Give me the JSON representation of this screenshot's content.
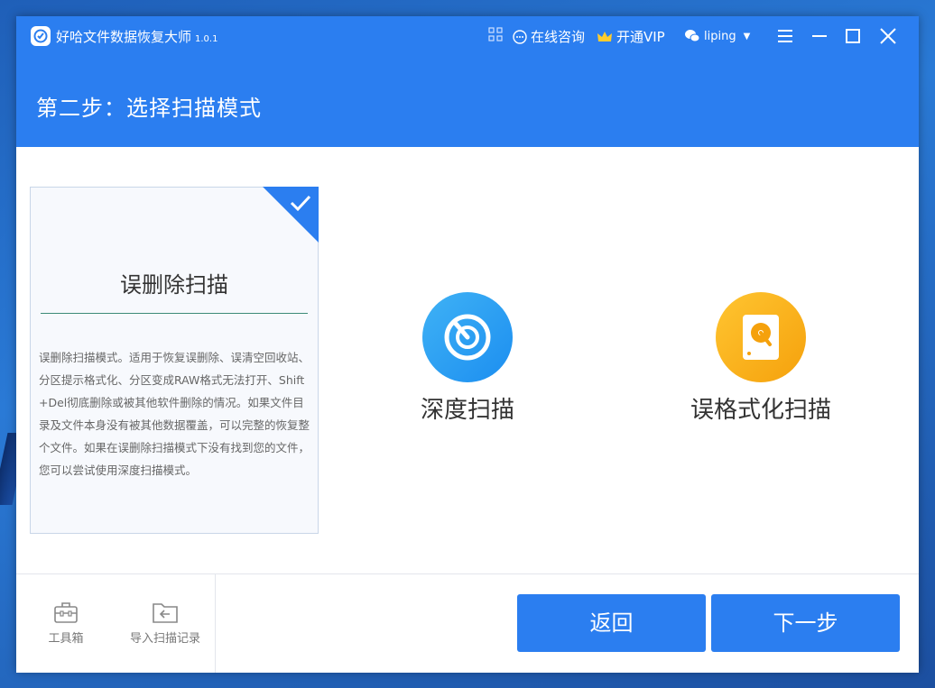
{
  "app": {
    "title": "好哈文件数据恢复大师",
    "version": "1.0.1",
    "consult_label": "在线咨询",
    "vip_label": "开通VIP",
    "username": "liping",
    "caret": "▼"
  },
  "step": {
    "title": "第二步：选择扫描模式"
  },
  "modes": {
    "deleted": {
      "label": "误删除扫描",
      "selected": true,
      "description": "误删除扫描模式。适用于恢复误删除、误清空回收站、分区提示格式化、分区变成RAW格式无法打开、Shift+Del彻底删除或被其他软件删除的情况。如果文件目录及文件本身没有被其他数据覆盖，可以完整的恢复整个文件。如果在误删除扫描模式下没有找到您的文件，您可以尝试使用深度扫描模式。"
    },
    "deep": {
      "label": "深度扫描",
      "icon": "radar-icon"
    },
    "format": {
      "label": "误格式化扫描",
      "icon": "disk-icon"
    }
  },
  "footer": {
    "toolbox_label": "工具箱",
    "import_label": "导入扫描记录",
    "back_label": "返回",
    "next_label": "下一步"
  },
  "colors": {
    "primary": "#2b7ef0",
    "deep_icon": "#1c8ef0",
    "format_icon": "#f5a10c",
    "divider": "#3c8a78"
  }
}
